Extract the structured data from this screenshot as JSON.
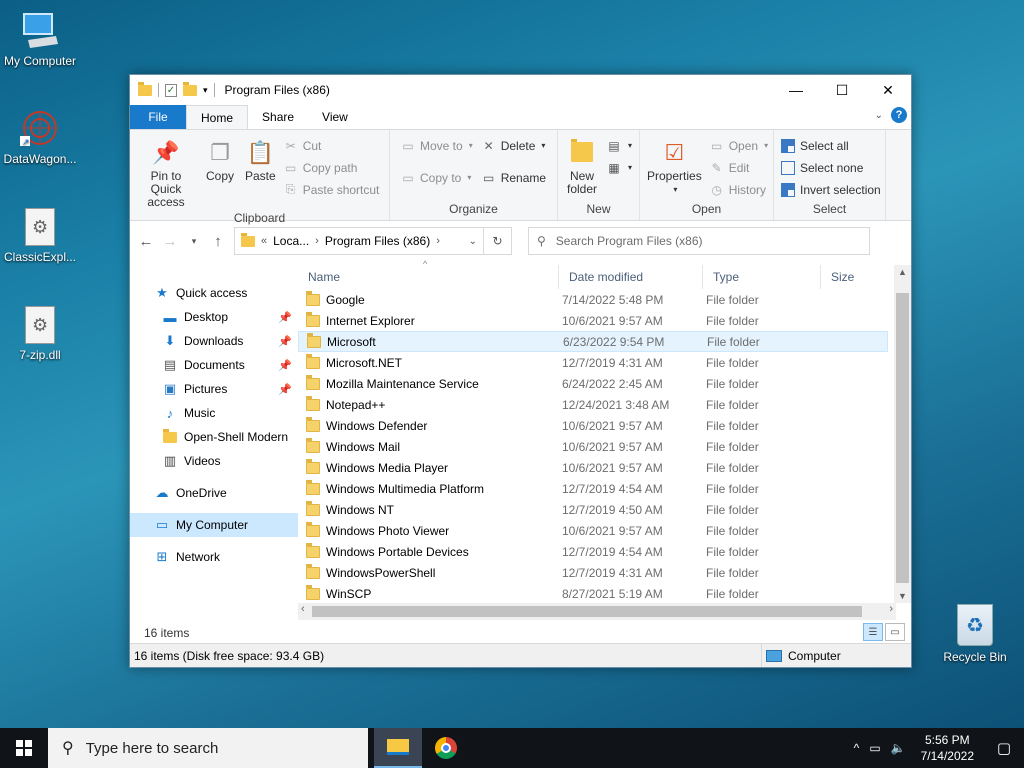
{
  "desktop": {
    "icons": [
      {
        "label": "My Computer",
        "icon": "computer-icon"
      },
      {
        "label": "DataWagon...",
        "icon": "datawagon-icon"
      },
      {
        "label": "ClassicExpl...",
        "icon": "dll-file-icon"
      },
      {
        "label": "7-zip.dll",
        "icon": "dll-file-icon"
      },
      {
        "label": "Recycle Bin",
        "icon": "recycle-bin-icon"
      }
    ]
  },
  "window": {
    "title": "Program Files (x86)",
    "tabs": {
      "file": "File",
      "home": "Home",
      "share": "Share",
      "view": "View"
    },
    "ribbon": {
      "clipboard": {
        "label": "Clipboard",
        "pin": "Pin to Quick access",
        "copy": "Copy",
        "paste": "Paste",
        "cut": "Cut",
        "copy_path": "Copy path",
        "paste_shortcut": "Paste shortcut"
      },
      "organize": {
        "label": "Organize",
        "move_to": "Move to",
        "copy_to": "Copy to",
        "delete": "Delete",
        "rename": "Rename"
      },
      "new": {
        "label": "New",
        "new_folder": "New folder"
      },
      "open": {
        "label": "Open",
        "properties": "Properties",
        "open": "Open",
        "edit": "Edit",
        "history": "History"
      },
      "select": {
        "label": "Select",
        "select_all": "Select all",
        "select_none": "Select none",
        "invert": "Invert selection"
      }
    },
    "address": {
      "crumb1": "Loca...",
      "crumb2": "Program Files (x86)"
    },
    "search_placeholder": "Search Program Files (x86)",
    "nav": {
      "quick_access": "Quick access",
      "desktop": "Desktop",
      "downloads": "Downloads",
      "documents": "Documents",
      "pictures": "Pictures",
      "music": "Music",
      "openshell": "Open-Shell Modern",
      "videos": "Videos",
      "onedrive": "OneDrive",
      "mycomputer": "My Computer",
      "network": "Network"
    },
    "columns": {
      "name": "Name",
      "date": "Date modified",
      "type": "Type",
      "size": "Size"
    },
    "files": [
      {
        "name": "Google",
        "date": "7/14/2022 5:48 PM",
        "type": "File folder"
      },
      {
        "name": "Internet Explorer",
        "date": "10/6/2021 9:57 AM",
        "type": "File folder"
      },
      {
        "name": "Microsoft",
        "date": "6/23/2022 9:54 PM",
        "type": "File folder"
      },
      {
        "name": "Microsoft.NET",
        "date": "12/7/2019 4:31 AM",
        "type": "File folder"
      },
      {
        "name": "Mozilla Maintenance Service",
        "date": "6/24/2022 2:45 AM",
        "type": "File folder"
      },
      {
        "name": "Notepad++",
        "date": "12/24/2021 3:48 AM",
        "type": "File folder"
      },
      {
        "name": "Windows Defender",
        "date": "10/6/2021 9:57 AM",
        "type": "File folder"
      },
      {
        "name": "Windows Mail",
        "date": "10/6/2021 9:57 AM",
        "type": "File folder"
      },
      {
        "name": "Windows Media Player",
        "date": "10/6/2021 9:57 AM",
        "type": "File folder"
      },
      {
        "name": "Windows Multimedia Platform",
        "date": "12/7/2019 4:54 AM",
        "type": "File folder"
      },
      {
        "name": "Windows NT",
        "date": "12/7/2019 4:50 AM",
        "type": "File folder"
      },
      {
        "name": "Windows Photo Viewer",
        "date": "10/6/2021 9:57 AM",
        "type": "File folder"
      },
      {
        "name": "Windows Portable Devices",
        "date": "12/7/2019 4:54 AM",
        "type": "File folder"
      },
      {
        "name": "WindowsPowerShell",
        "date": "12/7/2019 4:31 AM",
        "type": "File folder"
      },
      {
        "name": "WinSCP",
        "date": "8/27/2021 5:19 AM",
        "type": "File folder"
      }
    ],
    "item_count": "16 items",
    "status_left": "16 items (Disk free space: 93.4 GB)",
    "status_right": "Computer"
  },
  "taskbar": {
    "search_placeholder": "Type here to search",
    "time": "5:56 PM",
    "date": "7/14/2022"
  },
  "colors": {
    "accent": "#1979ca",
    "selection": "#cce8ff",
    "taskbar": "#101418"
  }
}
